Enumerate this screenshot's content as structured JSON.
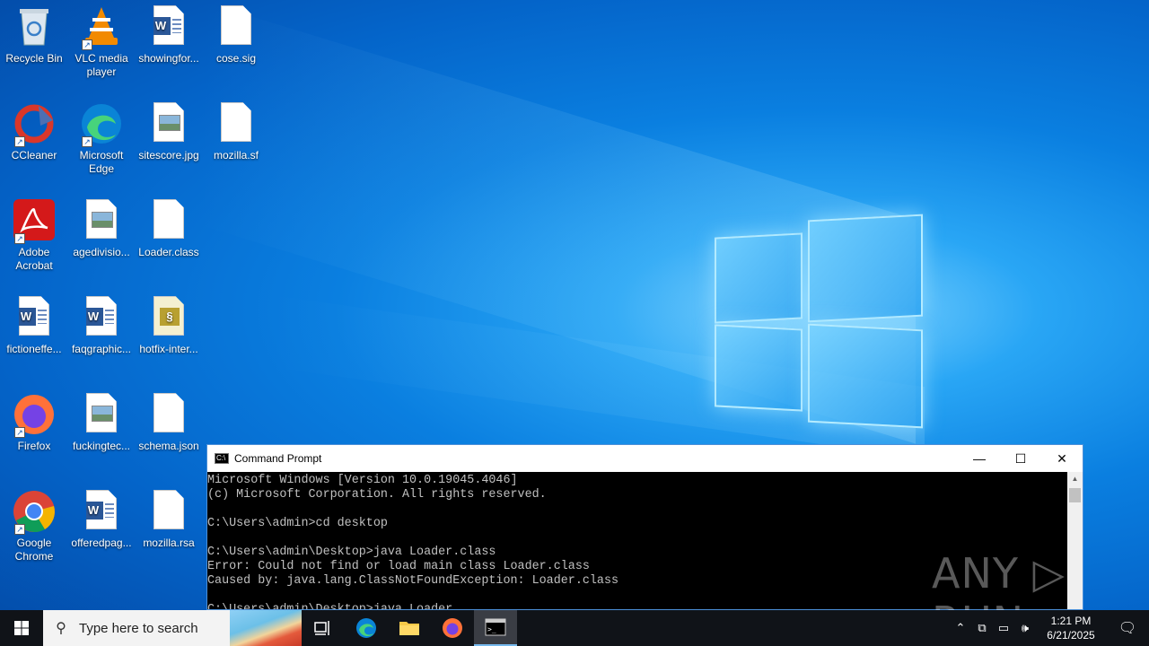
{
  "desktop": {
    "icons": [
      {
        "label": "Recycle Bin",
        "glyph": "recycle-bin-icon"
      },
      {
        "label": "VLC media player",
        "glyph": "vlc-icon"
      },
      {
        "label": "showingfor...",
        "glyph": "word-doc-icon"
      },
      {
        "label": "cose.sig",
        "glyph": "file-icon"
      },
      {
        "label": "CCleaner",
        "glyph": "ccleaner-icon"
      },
      {
        "label": "Microsoft Edge",
        "glyph": "edge-icon"
      },
      {
        "label": "sitescore.jpg",
        "glyph": "image-icon"
      },
      {
        "label": "mozilla.sf",
        "glyph": "file-icon"
      },
      {
        "label": "Adobe Acrobat",
        "glyph": "acrobat-icon"
      },
      {
        "label": "agedivisio...",
        "glyph": "image-icon"
      },
      {
        "label": "Loader.class",
        "glyph": "file-icon"
      },
      {
        "label": "fictioneffe...",
        "glyph": "word-doc-icon"
      },
      {
        "label": "faqgraphic...",
        "glyph": "word-doc-icon"
      },
      {
        "label": "hotfix-inter...",
        "glyph": "script-icon"
      },
      {
        "label": "Firefox",
        "glyph": "firefox-icon"
      },
      {
        "label": "fuckingtec...",
        "glyph": "image-icon"
      },
      {
        "label": "schema.json",
        "glyph": "file-icon"
      },
      {
        "label": "Google Chrome",
        "glyph": "chrome-icon"
      },
      {
        "label": "offeredpag...",
        "glyph": "word-doc-icon"
      },
      {
        "label": "mozilla.rsa",
        "glyph": "file-icon"
      }
    ]
  },
  "cmd": {
    "title": "Command Prompt",
    "minimize": "—",
    "maximize": "☐",
    "close": "✕",
    "lines": [
      "Microsoft Windows [Version 10.0.19045.4046]",
      "(c) Microsoft Corporation. All rights reserved.",
      "",
      "C:\\Users\\admin>cd desktop",
      "",
      "C:\\Users\\admin\\Desktop>java Loader.class",
      "Error: Could not find or load main class Loader.class",
      "Caused by: java.lang.ClassNotFoundException: Loader.class",
      "",
      "C:\\Users\\admin\\Desktop>java Loader"
    ]
  },
  "watermark": "ANY ▷ RUN",
  "taskbar": {
    "search_placeholder": "Type here to search",
    "time": "1:21 PM",
    "date": "6/21/2025"
  }
}
